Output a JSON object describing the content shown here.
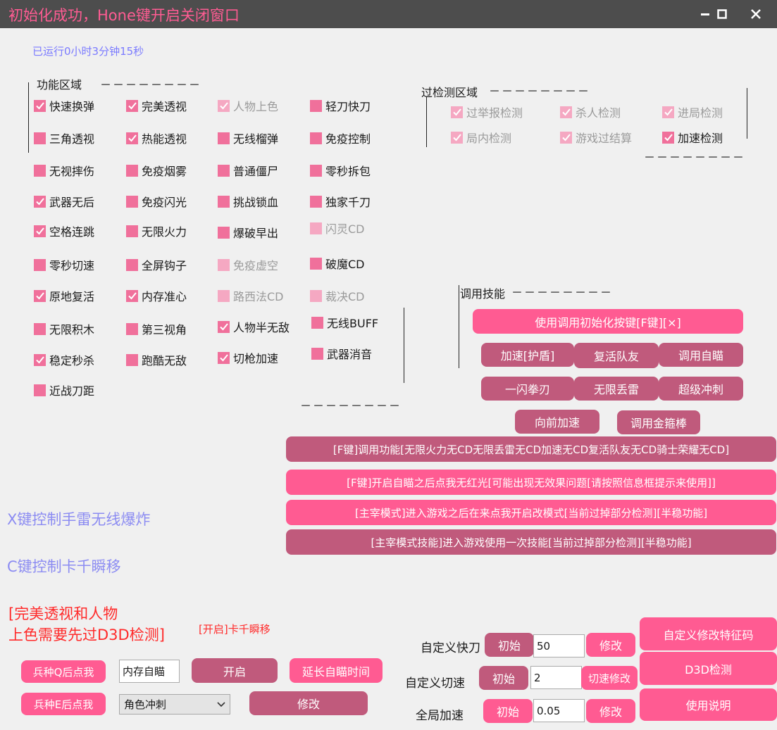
{
  "window": {
    "title": "初始化成功，Hone键开启关闭窗口",
    "minimize_icon": "minimize-icon",
    "maximize_icon": "maximize-icon",
    "close_icon": "close-icon"
  },
  "status": {
    "runtime": "已运行0小时3分钟15秒"
  },
  "function_area": {
    "title": "功能区域",
    "dashes": "－－－－－－－－",
    "bottom_dashes": "－－－－－－－－",
    "checkboxes": [
      {
        "label": "快速换弹",
        "checked": true,
        "disabled": false
      },
      {
        "label": "完美透视",
        "checked": true,
        "disabled": false
      },
      {
        "label": "人物上色",
        "checked": true,
        "disabled": true
      },
      {
        "label": "轻刀快刀",
        "checked": false,
        "disabled": false
      },
      {
        "label": "三角透视",
        "checked": false,
        "disabled": false
      },
      {
        "label": "热能透视",
        "checked": true,
        "disabled": false
      },
      {
        "label": "无线榴弹",
        "checked": false,
        "disabled": false
      },
      {
        "label": "免疫控制",
        "checked": false,
        "disabled": false
      },
      {
        "label": "无视摔伤",
        "checked": false,
        "disabled": false
      },
      {
        "label": "免疫烟雾",
        "checked": false,
        "disabled": false
      },
      {
        "label": "普通僵尸",
        "checked": false,
        "disabled": false
      },
      {
        "label": "零秒拆包",
        "checked": false,
        "disabled": false
      },
      {
        "label": "武器无后",
        "checked": true,
        "disabled": false
      },
      {
        "label": "免疫闪光",
        "checked": false,
        "disabled": false
      },
      {
        "label": "挑战锁血",
        "checked": false,
        "disabled": false
      },
      {
        "label": "独家千刀",
        "checked": false,
        "disabled": false
      },
      {
        "label": "空格连跳",
        "checked": true,
        "disabled": false
      },
      {
        "label": "无限火力",
        "checked": false,
        "disabled": false
      },
      {
        "label": "爆破早出",
        "checked": false,
        "disabled": false
      },
      {
        "label": "闪灵CD",
        "checked": false,
        "disabled": true
      },
      {
        "label": "零秒切速",
        "checked": false,
        "disabled": false
      },
      {
        "label": "全屏钩子",
        "checked": false,
        "disabled": false
      },
      {
        "label": "免疫虚空",
        "checked": false,
        "disabled": true
      },
      {
        "label": "破魔CD",
        "checked": false,
        "disabled": false
      },
      {
        "label": "原地复活",
        "checked": true,
        "disabled": false
      },
      {
        "label": "内存准心",
        "checked": true,
        "disabled": false
      },
      {
        "label": "路西法CD",
        "checked": false,
        "disabled": true
      },
      {
        "label": "裁决CD",
        "checked": false,
        "disabled": true
      },
      {
        "label": "无限积木",
        "checked": false,
        "disabled": false
      },
      {
        "label": "第三视角",
        "checked": false,
        "disabled": false
      },
      {
        "label": "人物半无敌",
        "checked": true,
        "disabled": false
      },
      {
        "label": "无线BUFF",
        "checked": false,
        "disabled": false
      },
      {
        "label": "稳定秒杀",
        "checked": true,
        "disabled": false
      },
      {
        "label": "跑酷无敌",
        "checked": false,
        "disabled": false
      },
      {
        "label": "切枪加速",
        "checked": true,
        "disabled": false
      },
      {
        "label": "武器消音",
        "checked": false,
        "disabled": false
      },
      {
        "label": "近战刀距",
        "checked": false,
        "disabled": false
      }
    ]
  },
  "detect_area": {
    "title": "过检测区域",
    "dashes": "－－－－－－－－",
    "bottom_dashes": "－－－－－－－－",
    "checkboxes": [
      {
        "label": "过举报检测",
        "checked": true,
        "disabled": true
      },
      {
        "label": "杀人检测",
        "checked": true,
        "disabled": true
      },
      {
        "label": "进局检测",
        "checked": true,
        "disabled": true
      },
      {
        "label": "局内检测",
        "checked": true,
        "disabled": true
      },
      {
        "label": "游戏过结算",
        "checked": true,
        "disabled": true
      },
      {
        "label": "加速检测",
        "checked": true,
        "disabled": false
      }
    ]
  },
  "skills": {
    "title": "调用技能",
    "dashes": "－－－－－－－－",
    "init_button": "使用调用初始化按键[F键][×]",
    "buttons": [
      "加速[护盾]",
      "复活队友",
      "调用自瞄",
      "一闪拳刃",
      "无限丢雷",
      "超级冲刺",
      "向前加速",
      "调用金箍棒"
    ]
  },
  "long_buttons": [
    "[F键]调用功能[无限火力无CD无限丢雷无CD加速无CD复活队友无CD骑士荣耀无CD]",
    "[F键]开启自瞄之后点我无红光[可能出现无效果问题[请按照信息框提示来使用]]",
    "[主宰模式]进入游戏之后在来点我开启改模式[当前过掉部分检测][半稳功能]",
    "[主宰模式技能]进入游戏使用一次技能[当前过掉部分检测][半稳功能]"
  ],
  "hints": {
    "x_key": "X键控制手雷无线爆炸",
    "c_key": "C键控制卡千瞬移",
    "d3d_line1": "[完美透视和人物",
    "d3d_line2": "上色需要先过D3D检测]",
    "open_status": "[开启]卡千瞬移"
  },
  "bottom_left": {
    "q_button": "兵种Q后点我",
    "e_button": "兵种E后点我",
    "aim_input": "内存自瞄",
    "open_button": "开启",
    "extend_button": "延长自瞄时间",
    "select_value": "角色冲刺",
    "modify_button": "修改",
    "select_arrow_icon": "chevron-down-icon"
  },
  "custom": {
    "fast_knife_label": "自定义快刀",
    "fast_knife_init": "初始",
    "fast_knife_value": "50",
    "fast_knife_modify": "修改",
    "switch_speed_label": "自定义切速",
    "switch_speed_init": "初始",
    "switch_speed_value": "2",
    "switch_speed_modify": "切速修改",
    "global_speed_label": "全局加速",
    "global_speed_init": "初始",
    "global_speed_value": "0.05",
    "global_speed_modify": "修改"
  },
  "right_buttons": {
    "signature": "自定义修改特征码",
    "d3d": "D3D检测",
    "manual": "使用说明"
  },
  "colors": {
    "pink": "#ff5b92",
    "dark_pink": "#c05a7c",
    "checkbox": "#f0709b",
    "title_text": "#ff5c93",
    "hint_blue": "#8c8cf2",
    "warning_red": "#ff2a2a"
  }
}
